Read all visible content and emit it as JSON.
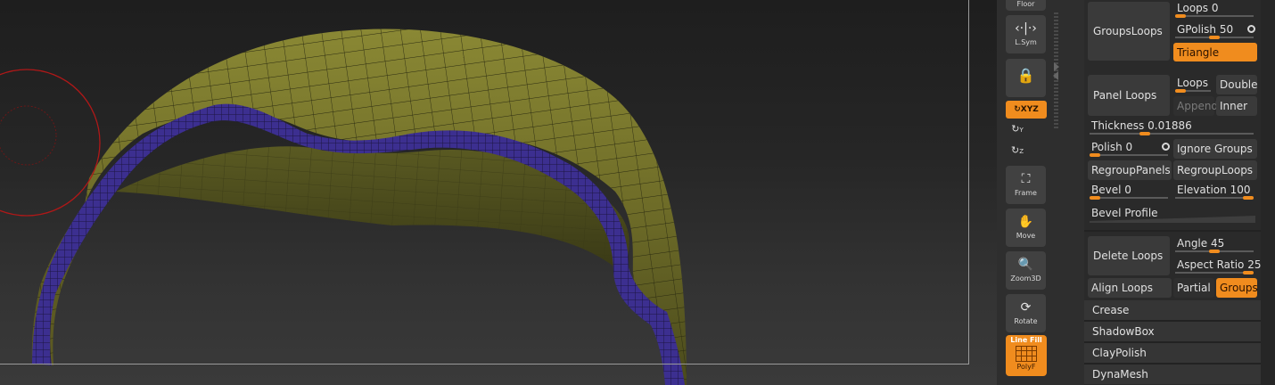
{
  "dock": {
    "floor_label": "Floor",
    "lsym_label": "L.Sym",
    "xyz_label": "XYZ",
    "y_label": "Y",
    "z_label": "Z",
    "frame_label": "Frame",
    "move_label": "Move",
    "zoom3d_label": "Zoom3D",
    "rotate_label": "Rotate",
    "linefill_label": "Line Fill",
    "polyf_label": "PolyF"
  },
  "panel": {
    "groups_loops": "GroupsLoops",
    "loops_slider": {
      "label": "Loops",
      "value": "0",
      "level": 0
    },
    "gpolish_slider": {
      "label": "GPolish",
      "value": "50",
      "level": 0.5
    },
    "triangle": "Triangle",
    "panel_loops": "Panel Loops",
    "loops_toggle": "Loops",
    "double": "Double",
    "append": "Append",
    "inner": "Inner",
    "thickness_slider": {
      "label": "Thickness",
      "value": "0.01886",
      "level": 0.36
    },
    "polish_slider": {
      "label": "Polish",
      "value": "0",
      "level": 0
    },
    "ignore_groups": "Ignore Groups",
    "regroup_panels": "RegroupPanels",
    "regroup_loops": "RegroupLoops",
    "bevel_slider": {
      "label": "Bevel",
      "value": "0",
      "level": 0
    },
    "elevation_slider": {
      "label": "Elevation",
      "value": "100",
      "level": 1
    },
    "bevel_profile": "Bevel Profile",
    "delete_loops": "Delete Loops",
    "angle_slider": {
      "label": "Angle",
      "value": "45",
      "level": 0.5
    },
    "aspect_ratio_slider": {
      "label": "Aspect Ratio",
      "value": "25",
      "level": 0.9
    },
    "align_loops": "Align Loops",
    "partial": "Partial",
    "groups": "Groups",
    "crease": "Crease",
    "shadowbox": "ShadowBox",
    "claypolish": "ClayPolish",
    "dynamesh": "DynaMesh"
  },
  "colors": {
    "accent": "#f08c1e",
    "mesh_surface": "#6b6a24",
    "mesh_edge": "#4a3a9a",
    "brush_circle": "#c02020"
  }
}
